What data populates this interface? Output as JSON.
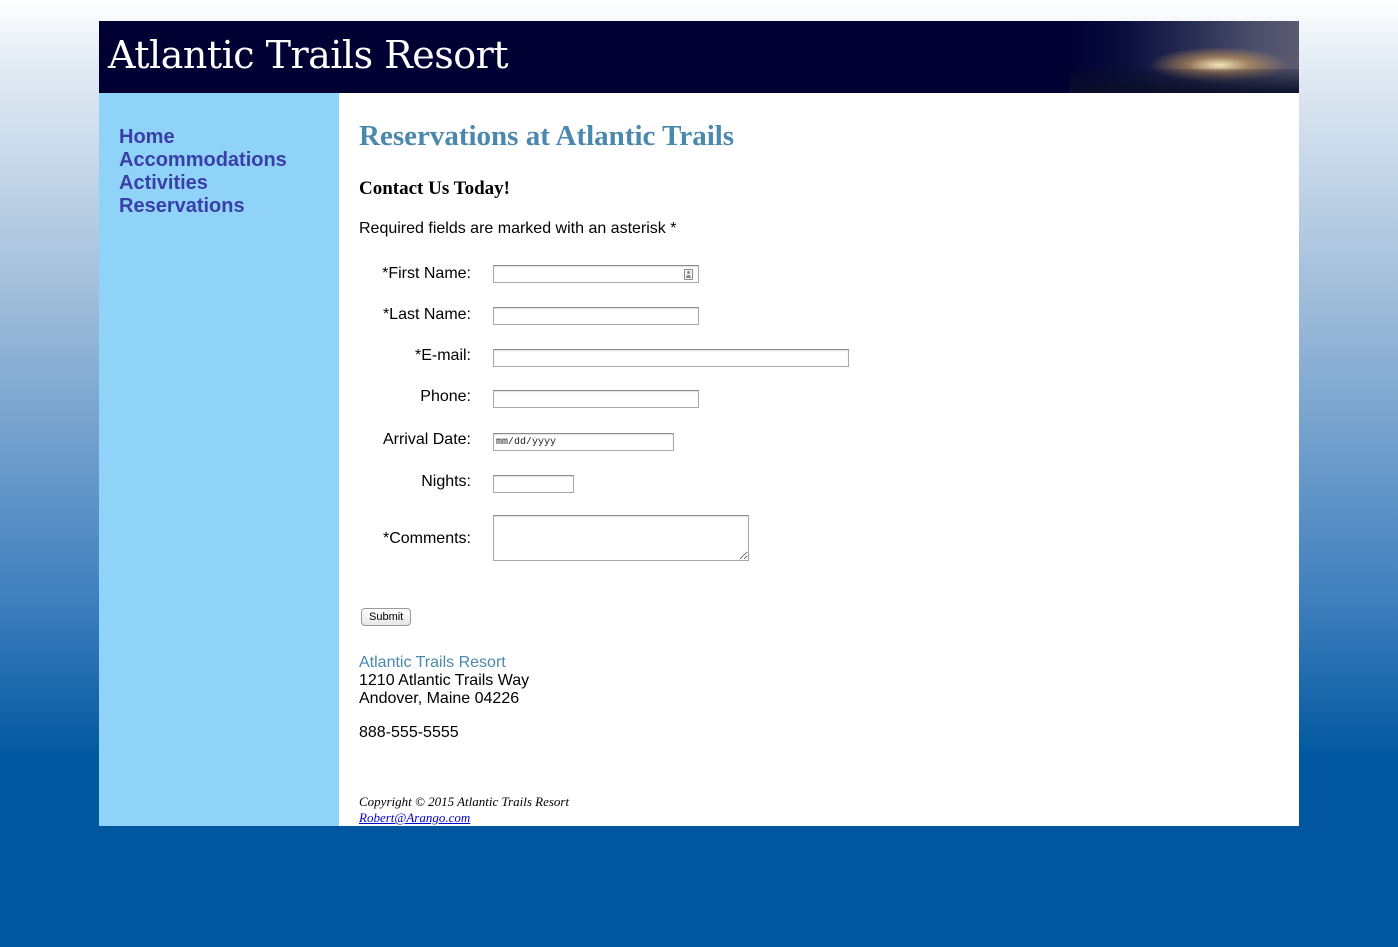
{
  "header": {
    "title": "Atlantic Trails Resort"
  },
  "nav": {
    "items": [
      {
        "label": "Home"
      },
      {
        "label": "Accommodations"
      },
      {
        "label": "Activities"
      },
      {
        "label": "Reservations"
      }
    ]
  },
  "main": {
    "heading": "Reservations at Atlantic Trails",
    "subheading": "Contact Us Today!",
    "required_note": "Required fields are marked with an asterisk *"
  },
  "form": {
    "first_name": {
      "label": "*First Name:",
      "value": ""
    },
    "last_name": {
      "label": "*Last Name:",
      "value": ""
    },
    "email": {
      "label": "*E-mail:",
      "value": ""
    },
    "phone": {
      "label": "Phone:",
      "value": ""
    },
    "arrival_date": {
      "label": "Arrival Date:",
      "placeholder": "mm/dd/yyyy"
    },
    "nights": {
      "label": "Nights:",
      "value": ""
    },
    "comments": {
      "label": "*Comments:",
      "value": ""
    },
    "submit_label": "Submit"
  },
  "contact": {
    "resort_name": "Atlantic Trails Resort",
    "street": "1210 Atlantic Trails Way",
    "city_state_zip": "Andover, Maine 04226",
    "phone": "888-555-5555"
  },
  "footer": {
    "copyright": "Copyright © 2015 Atlantic Trails Resort",
    "email": "Robert@Arango.com"
  },
  "colors": {
    "header_bg": "#000033",
    "nav_bg": "#90d3f9",
    "nav_link": "#3a3fa8",
    "heading": "#4a88ad",
    "page_bg_bottom": "#00579f"
  }
}
